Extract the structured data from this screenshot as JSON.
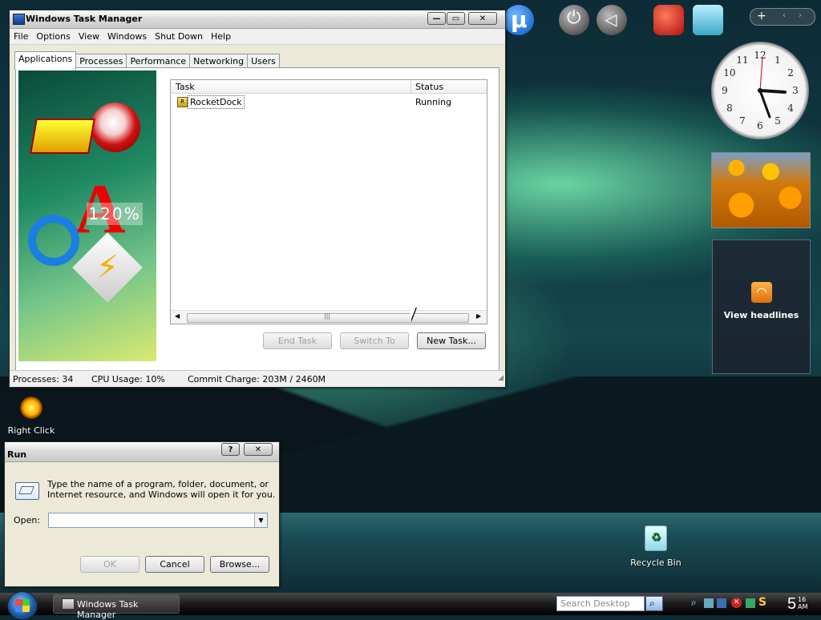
{
  "task_manager": {
    "title": "Windows Task Manager",
    "menu": [
      "File",
      "Options",
      "View",
      "Windows",
      "Shut Down",
      "Help"
    ],
    "tabs": [
      "Applications",
      "Processes",
      "Performance",
      "Networking",
      "Users"
    ],
    "active_tab": "Applications",
    "columns": [
      "Task",
      "Status"
    ],
    "rows": [
      {
        "task": "RocketDock",
        "status": "Running"
      }
    ],
    "buttons": {
      "end_task": "End Task",
      "switch_to": "Switch To",
      "new_task": "New Task..."
    },
    "banner_text": "120%",
    "status": {
      "processes": "Processes: 34",
      "cpu": "CPU Usage: 10%",
      "commit": "Commit Charge: 203M / 2460M"
    }
  },
  "run_dialog": {
    "title": "Run",
    "help": "?",
    "description_line1": "Type the name of a program, folder, document, or",
    "description_line2": "Internet resource, and Windows will open it for you.",
    "open_label": "Open:",
    "open_value": "",
    "buttons": {
      "ok": "OK",
      "cancel": "Cancel",
      "browse": "Browse..."
    }
  },
  "desktop": {
    "icons": [
      {
        "label": "Right Click Image"
      },
      {
        "label": "Recycle Bin"
      }
    ],
    "rss_gadget": "View headlines"
  },
  "taskbar": {
    "window_button": "Windows Task Manager",
    "search_placeholder": "Search Desktop",
    "clock_hour": "5",
    "clock_minute": "16",
    "clock_ampm": "AM"
  },
  "analog_clock": {
    "numerals": [
      "12",
      "1",
      "2",
      "3",
      "4",
      "5",
      "6",
      "7",
      "8",
      "9",
      "10",
      "11"
    ]
  }
}
